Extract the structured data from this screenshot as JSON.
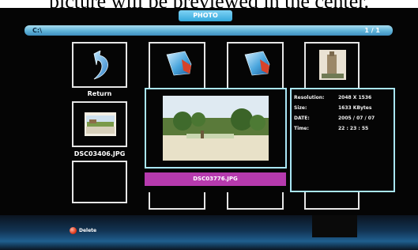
{
  "caption": "picture will be previewed in the center.",
  "header": {
    "title": "PHOTO",
    "path": "C:\\",
    "page": "1 / 1"
  },
  "return": {
    "label": "Return",
    "icon": "return-arrow-icon"
  },
  "left_thumb": {
    "filename": "DSC03406.JPG"
  },
  "selected": {
    "filename": "DSC03776.JPG"
  },
  "info": {
    "rows": [
      {
        "key": "Resolution:",
        "value": "2048 X 1536"
      },
      {
        "key": "Size:",
        "value": "1633 KBytes"
      },
      {
        "key": "DATE:",
        "value": "2005 / 07 / 07"
      },
      {
        "key": "Time:",
        "value": "22 : 23 : 55"
      }
    ]
  },
  "footer": {
    "delete_label": "Delete",
    "delete_icon": "red-circle-icon"
  },
  "colors": {
    "accent": "#35a8dc",
    "selected_bar": "#b63aae",
    "highlight_border": "#a9e6f5"
  }
}
